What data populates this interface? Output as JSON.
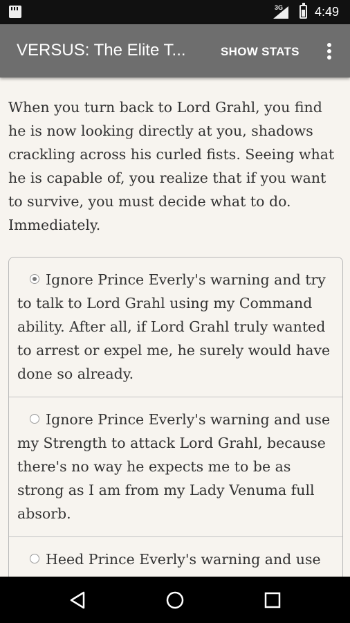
{
  "status_bar": {
    "network_type": "3G",
    "time": "4:49"
  },
  "app_bar": {
    "title": "VERSUS: The Elite T...",
    "show_stats_label": "SHOW STATS",
    "overflow_icon": "more-vert-icon"
  },
  "story": {
    "passage": "When you turn back to Lord Grahl, you find he is now looking directly at you, shadows crackling across his curled fists. Seeing what he is capable of, you realize that if you want to survive, you must decide what to do. Immediately."
  },
  "choices": [
    {
      "text": "Ignore Prince Everly's warning and try to talk to Lord Grahl using my Command ability. After all, if Lord Grahl truly wanted to arrest or expel me, he surely would have done so already.",
      "selected": true
    },
    {
      "text": "Ignore Prince Everly's warning and use my Strength to attack Lord Grahl, because there's no way he expects me to be as strong as I am from my Lady Venuma full absorb.",
      "selected": false
    },
    {
      "text": "Heed Prince Everly's warning and use",
      "selected": false
    }
  ],
  "nav_bar": {
    "back_icon": "back-triangle-icon",
    "home_icon": "home-circle-icon",
    "recents_icon": "recents-square-icon"
  }
}
